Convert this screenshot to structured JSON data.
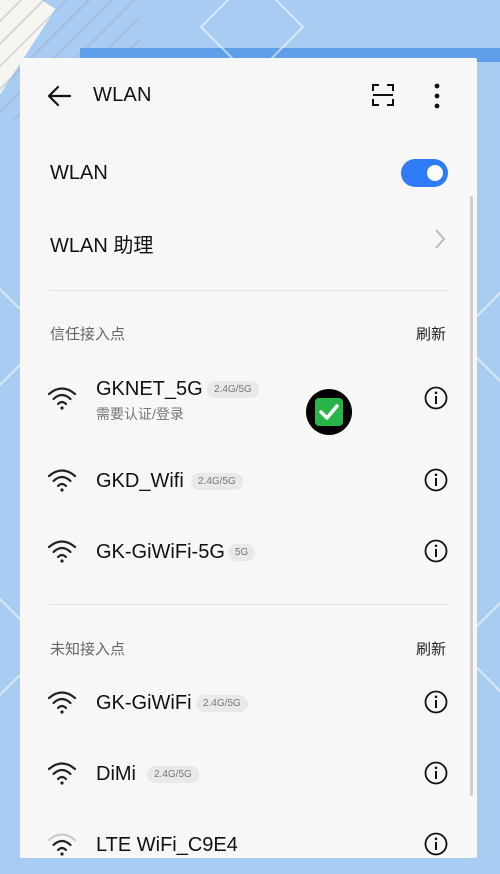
{
  "header": {
    "title": "WLAN"
  },
  "wlan_row": {
    "label": "WLAN",
    "enabled": true
  },
  "assistant_row": {
    "label": "WLAN 助理"
  },
  "trusted": {
    "title": "信任接入点",
    "refresh": "刷新",
    "networks": [
      {
        "ssid": "GKNET_5G",
        "band": "2.4G/5G",
        "sub": "需要认证/登录"
      },
      {
        "ssid": "GKD_Wifi",
        "band": "2.4G/5G"
      },
      {
        "ssid": "GK-GiWiFi-5G",
        "band": "5G"
      }
    ]
  },
  "unknown": {
    "title": "未知接入点",
    "refresh": "刷新",
    "networks": [
      {
        "ssid": "GK-GiWiFi",
        "band": "2.4G/5G"
      },
      {
        "ssid": "DiMi",
        "band": "2.4G/5G"
      },
      {
        "ssid": "LTE WiFi_C9E4"
      }
    ]
  },
  "colors": {
    "accent": "#2f7bf5",
    "check_green": "#29b44a"
  },
  "icons": [
    "back-arrow-icon",
    "scan-icon",
    "more-vertical-icon",
    "chevron-right-icon",
    "wifi-icon",
    "info-icon",
    "check-icon"
  ]
}
